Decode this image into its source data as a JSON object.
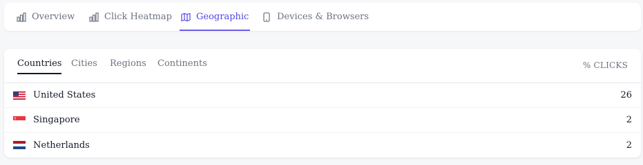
{
  "nav_tabs": [
    {
      "label": "Overview",
      "icon": "bar-chart-icon"
    },
    {
      "label": "Click Heatmap",
      "icon": "bar-chart-icon"
    },
    {
      "label": "Geographic",
      "icon": "map-icon",
      "active": true
    },
    {
      "label": "Devices & Browsers",
      "icon": "phone-icon"
    }
  ],
  "sub_tabs": [
    {
      "label": "Countries",
      "active": true
    },
    {
      "label": "Cities"
    },
    {
      "label": "Regions"
    },
    {
      "label": "Continents"
    }
  ],
  "column_header": "% CLICKS",
  "rows": [
    {
      "country": "United States",
      "flag": "us-flag-icon",
      "percent": "26"
    },
    {
      "country": "Singapore",
      "flag": "sg-flag-icon",
      "percent": "2"
    },
    {
      "country": "Netherlands",
      "flag": "nl-flag-icon",
      "percent": "2"
    }
  ],
  "colors": {
    "accent": "#4f46e5",
    "text_muted": "#6b7280",
    "text_main": "#111827"
  }
}
